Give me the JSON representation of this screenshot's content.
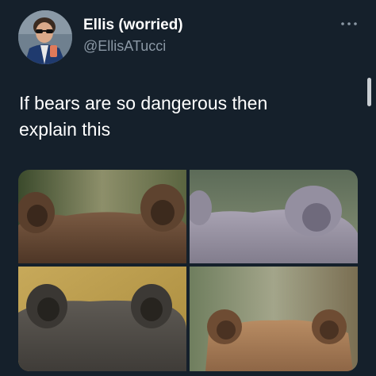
{
  "tweet": {
    "display_name": "Ellis (worried)",
    "handle": "@EllisATucci",
    "text_lines": [
      "If bears are so dangerous then",
      "explain this"
    ],
    "more_icon": "more-horizontal-icon",
    "avatar_icon": "user-avatar"
  },
  "media": {
    "images": [
      {
        "subject": "brown bear head from behind, round ears",
        "tone": "#6b4a34"
      },
      {
        "subject": "grey bear head from behind, fluffy ears",
        "tone": "#8f8a98"
      },
      {
        "subject": "dark bear head from behind, rounded ears",
        "tone": "#4f4c47"
      },
      {
        "subject": "light brown bear head from behind",
        "tone": "#a47a55"
      }
    ]
  },
  "colors": {
    "background": "#15202b",
    "primary_text": "#ffffff",
    "secondary_text": "#8b98a5"
  }
}
